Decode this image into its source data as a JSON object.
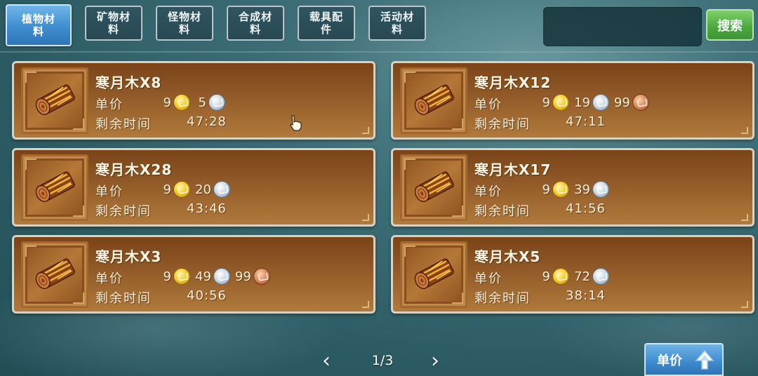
{
  "tabs": [
    {
      "line1": "植物材",
      "line2": "料",
      "active": true
    },
    {
      "line1": "矿物材",
      "line2": "料",
      "active": false
    },
    {
      "line1": "怪物材",
      "line2": "料",
      "active": false
    },
    {
      "line1": "合成材",
      "line2": "料",
      "active": false
    },
    {
      "line1": "载具配",
      "line2": "件",
      "active": false
    },
    {
      "line1": "活动材",
      "line2": "料",
      "active": false
    }
  ],
  "search": {
    "button_label": "搜索"
  },
  "labels": {
    "price": "单价",
    "time_left": "剩余时间"
  },
  "listings": [
    {
      "name": "寒月木X8",
      "gold": "9",
      "silver": "5",
      "copper": null,
      "time": "47:28",
      "icon": "wood-log-icon"
    },
    {
      "name": "寒月木X12",
      "gold": "9",
      "silver": "19",
      "copper": "99",
      "time": "47:11",
      "icon": "wood-log-icon"
    },
    {
      "name": "寒月木X28",
      "gold": "9",
      "silver": "20",
      "copper": null,
      "time": "43:46",
      "icon": "wood-log-icon"
    },
    {
      "name": "寒月木X17",
      "gold": "9",
      "silver": "39",
      "copper": null,
      "time": "41:56",
      "icon": "wood-log-icon"
    },
    {
      "name": "寒月木X3",
      "gold": "9",
      "silver": "49",
      "copper": "99",
      "time": "40:56",
      "icon": "wood-log-icon"
    },
    {
      "name": "寒月木X5",
      "gold": "9",
      "silver": "72",
      "copper": null,
      "time": "38:14",
      "icon": "wood-log-icon"
    }
  ],
  "pagination": {
    "text": "1/3",
    "prev_icon": "chevron-left-icon",
    "next_icon": "chevron-right-icon"
  },
  "sort": {
    "label": "单价",
    "icon": "sort-arrow-up-icon"
  },
  "colors": {
    "active_tab": "#3f8ccf",
    "search_button": "#4aa83e",
    "card_top": "#7a4418",
    "card_bottom": "#b07a3c",
    "gold_coin": "#f5c729",
    "silver_coin": "#c8d6e0",
    "copper_coin": "#d8875a"
  }
}
